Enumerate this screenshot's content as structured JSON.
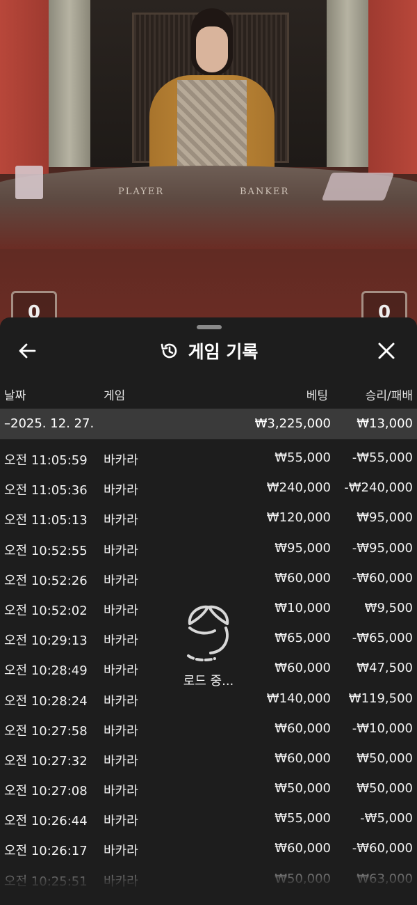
{
  "video": {
    "player_label": "PLAYER",
    "banker_label": "BANKER",
    "player_score": "0",
    "banker_score": "0"
  },
  "header": {
    "title": "게임 기록",
    "back_icon": "arrow-left-icon",
    "title_icon": "history-icon",
    "close_icon": "close-icon"
  },
  "columns": {
    "date": "날짜",
    "game": "게임",
    "bet": "베팅",
    "win_loss": "승리/패배"
  },
  "summary": {
    "date": "–2025. 12. 27.",
    "bet": "₩3,225,000",
    "win_loss": "₩13,000"
  },
  "rows": [
    {
      "date": "오전 11:05:59",
      "game": "바카라",
      "bet": "₩55,000",
      "win_loss": "-₩55,000"
    },
    {
      "date": "오전 11:05:36",
      "game": "바카라",
      "bet": "₩240,000",
      "win_loss": "-₩240,000"
    },
    {
      "date": "오전 11:05:13",
      "game": "바카라",
      "bet": "₩120,000",
      "win_loss": "₩95,000"
    },
    {
      "date": "오전 10:52:55",
      "game": "바카라",
      "bet": "₩95,000",
      "win_loss": "-₩95,000"
    },
    {
      "date": "오전 10:52:26",
      "game": "바카라",
      "bet": "₩60,000",
      "win_loss": "-₩60,000"
    },
    {
      "date": "오전 10:52:02",
      "game": "바카라",
      "bet": "₩10,000",
      "win_loss": "₩9,500"
    },
    {
      "date": "오전 10:29:13",
      "game": "바카라",
      "bet": "₩65,000",
      "win_loss": "-₩65,000"
    },
    {
      "date": "오전 10:28:49",
      "game": "바카라",
      "bet": "₩60,000",
      "win_loss": "₩47,500"
    },
    {
      "date": "오전 10:28:24",
      "game": "바카라",
      "bet": "₩140,000",
      "win_loss": "₩119,500"
    },
    {
      "date": "오전 10:27:58",
      "game": "바카라",
      "bet": "₩60,000",
      "win_loss": "-₩10,000"
    },
    {
      "date": "오전 10:27:32",
      "game": "바카라",
      "bet": "₩60,000",
      "win_loss": "₩50,000"
    },
    {
      "date": "오전 10:27:08",
      "game": "바카라",
      "bet": "₩50,000",
      "win_loss": "₩50,000"
    },
    {
      "date": "오전 10:26:44",
      "game": "바카라",
      "bet": "₩55,000",
      "win_loss": "-₩5,000"
    },
    {
      "date": "오전 10:26:17",
      "game": "바카라",
      "bet": "₩60,000",
      "win_loss": "-₩60,000"
    },
    {
      "date": "오전 10:25:51",
      "game": "바카라",
      "bet": "₩50,000",
      "win_loss": "₩63,000"
    }
  ],
  "loader": {
    "text": "로드 중...",
    "icon": "spinner-icon"
  }
}
